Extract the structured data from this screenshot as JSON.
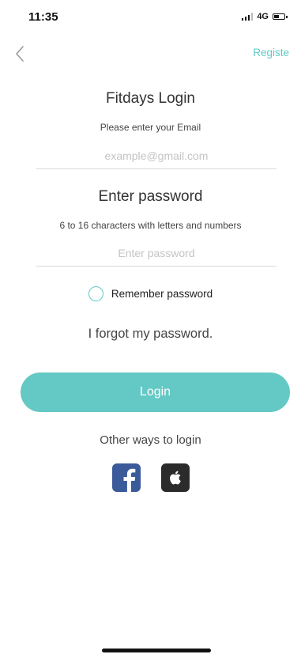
{
  "status_bar": {
    "time": "11:35",
    "network": "4G",
    "icons": [
      "signal-icon",
      "battery-icon"
    ]
  },
  "nav": {
    "back_icon": "chevron-left-icon",
    "register_label": "Registe"
  },
  "title": "Fitdays Login",
  "email": {
    "hint": "Please enter your Email",
    "placeholder": "example@gmail.com"
  },
  "password": {
    "title": "Enter password",
    "hint": "6 to 16 characters with letters and numbers",
    "placeholder": "Enter password"
  },
  "remember": {
    "label": "Remember password",
    "checked": false
  },
  "forgot_label": "I forgot my password.",
  "login_label": "Login",
  "other_ways_label": "Other ways to login",
  "social": [
    "facebook-icon",
    "apple-icon"
  ],
  "colors": {
    "accent": "#64c9c4",
    "facebook": "#3b5a9a",
    "apple": "#2b2b2b"
  }
}
